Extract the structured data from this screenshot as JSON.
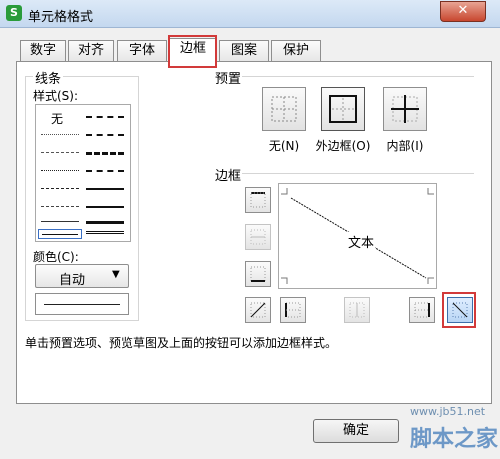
{
  "window": {
    "title": "单元格格式",
    "app_icon": "S",
    "close": "✕"
  },
  "tabs": [
    "数字",
    "对齐",
    "字体",
    "边框",
    "图案",
    "保护"
  ],
  "lines": {
    "group_label": "线条",
    "style_label": "样式(S):",
    "none_label": "无",
    "color_label": "颜色(C):",
    "color_value": "自动"
  },
  "presets": {
    "group_label": "预置",
    "items": [
      "无(N)",
      "外边框(O)",
      "内部(I)"
    ]
  },
  "border": {
    "group_label": "边框",
    "preview_text": "文本"
  },
  "hint": "单击预置选项、预览草图及上面的按钮可以添加边框样式。",
  "buttons": {
    "ok": "确定"
  },
  "watermark": {
    "url": "www.jb51.net",
    "text": "脚本之家"
  },
  "colors": {
    "highlight": "#d23a3a",
    "accent": "#2a9b3a"
  }
}
